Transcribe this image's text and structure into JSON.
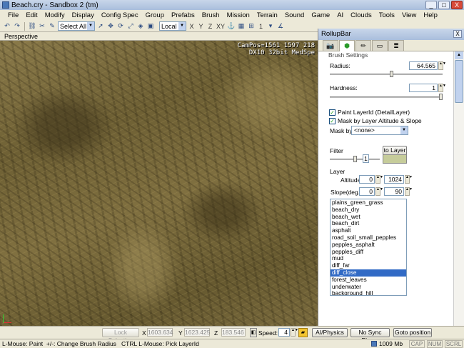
{
  "window": {
    "title": "Beach.cry - Sandbox 2 (tm)",
    "min": "_",
    "max": "□",
    "close": "X"
  },
  "menu": [
    "File",
    "Edit",
    "Modify",
    "Display",
    "Config Spec",
    "Group",
    "Prefabs",
    "Brush",
    "Mission",
    "Terrain",
    "Sound",
    "Game",
    "AI",
    "Clouds",
    "Tools",
    "View",
    "Help"
  ],
  "toolbar": {
    "selection": "Select All",
    "coord_system": "Local",
    "axes": [
      "X",
      "Y",
      "Z",
      "XY"
    ],
    "grid_value": "1"
  },
  "viewport": {
    "label": "Perspective",
    "campos_line": "CamPos=1561 1597 218",
    "render_line": "DX10 32bit MedSpe"
  },
  "rollup": {
    "title": "RollupBar",
    "close": "X",
    "brush_settings_label": "Brush Settings",
    "radius_label": "Radius:",
    "radius_value": "64.565",
    "radius_fraction": 0.55,
    "hardness_label": "Hardness:",
    "hardness_value": "1",
    "hardness_fraction": 1.0,
    "paint_layer_label": "Paint LayerId (DetailLayer)",
    "paint_layer_checked": true,
    "mask_altitude_label": "Mask by Layer Altitude & Slope",
    "mask_altitude_checked": true,
    "mask_by_label": "Mask by",
    "mask_by_value": "<none>",
    "filter_label": "Filter",
    "to_layer_button": "to Layer",
    "filter_value": "1",
    "filter_fraction": 0.5,
    "filter_color": "#c6cc9a",
    "layer_section_label": "Layer",
    "altitude_label": "Altitude",
    "altitude_min": "0",
    "altitude_max": "1024",
    "slope_label": "Slope(deg.)",
    "slope_min": "0",
    "slope_max": "90",
    "layers": [
      "plains_green_grass",
      "beach_dry",
      "beach_wet",
      "beach_dirt",
      "asphalt",
      "road_soil_small_pepples",
      "pepples_asphalt",
      "pepples_diff",
      "mud",
      "diff_far",
      "diff_close",
      "forest_leaves",
      "underwater",
      "background_hill"
    ],
    "selected_layer": "diff_close"
  },
  "status": {
    "lock_selection": "Lock Selection",
    "x_label": "X",
    "x_value": "1603.634",
    "y_label": "Y",
    "y_value": "1623.425",
    "z_label": "Z",
    "z_value": "183.546",
    "speed_label": "Speed:",
    "speed_value": "4",
    "ai_physics": "AI/Physics",
    "no_sync_player": "No Sync Player",
    "goto_position": "Goto position",
    "hint": "L-Mouse: Paint  +/-: Change Brush Radius   CTRL L-Mouse: Pick LayerId",
    "memory": "1009 Mb",
    "cap": "CAP",
    "num": "NUM",
    "scrl": "SCRL"
  }
}
